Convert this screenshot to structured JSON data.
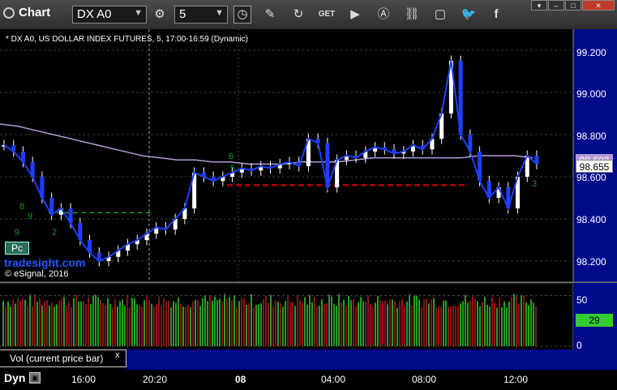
{
  "toolbar": {
    "app_title": "Chart",
    "symbol": "DX A0",
    "interval": "5",
    "buttons": [
      "settings-icon",
      "clock-icon",
      "pencil-icon",
      "refresh-icon",
      "get-icon",
      "play-icon",
      "alert-icon",
      "link-icon",
      "comment-icon",
      "twitter-icon",
      "facebook-icon"
    ],
    "window_buttons": [
      "pin-icon",
      "minimize-icon",
      "maximize-icon",
      "close-icon"
    ]
  },
  "chart": {
    "header": "* DX A0, US DOLLAR INDEX FUTURES, 5, 17:00-16:59 (Dynamic)",
    "y_ticks": [
      "99.200",
      "99.000",
      "98.800",
      "98.600",
      "98.400",
      "98.200"
    ],
    "ma_flag": "98.692",
    "last_flag": "98.655",
    "pc_label": "Pc",
    "brand": "tradesight.com",
    "copyright": "© eSignal, 2016",
    "annotations": [
      "6",
      "5",
      "8",
      "9",
      "9",
      "2",
      "3"
    ],
    "colors": {
      "price": "#1f3fff",
      "ma": "#b49bd6",
      "support": "#e00000",
      "level": "#1a9a1a",
      "axis_bg": "#000a8a"
    }
  },
  "volume": {
    "label": "Vol (current price bar)",
    "close": "x",
    "y_ticks": [
      "50",
      "0"
    ],
    "last_value": "29"
  },
  "x_axis": {
    "mode": "Dyn",
    "ticks": [
      "16:00",
      "20:20",
      "08",
      "04:00",
      "08:00",
      "12:00"
    ]
  },
  "chart_data": {
    "type": "candlestick",
    "title": "* DX A0, US DOLLAR INDEX FUTURES, 5, 17:00-16:59 (Dynamic)",
    "ylim": [
      98.1,
      99.3
    ],
    "x_ticks": [
      "16:00",
      "20:20",
      "08",
      "04:00",
      "08:00",
      "12:00"
    ],
    "series": [
      {
        "name": "price",
        "values": [
          98.75,
          98.72,
          98.67,
          98.6,
          98.5,
          98.42,
          98.45,
          98.38,
          98.3,
          98.24,
          98.2,
          98.22,
          98.25,
          98.28,
          98.3,
          98.33,
          98.36,
          98.35,
          98.4,
          98.45,
          98.62,
          98.6,
          98.58,
          98.6,
          98.62,
          98.64,
          98.63,
          98.65,
          98.64,
          98.66,
          98.67,
          98.65,
          98.78,
          98.76,
          98.55,
          98.68,
          98.7,
          98.69,
          98.72,
          98.74,
          98.73,
          98.71,
          98.72,
          98.75,
          98.73,
          98.78,
          98.9,
          99.15,
          98.8,
          98.72,
          98.58,
          98.5,
          98.55,
          98.45,
          98.6,
          98.7,
          98.66
        ]
      },
      {
        "name": "moving average",
        "values": [
          98.85,
          98.84,
          98.82,
          98.8,
          98.78,
          98.76,
          98.74,
          98.72,
          98.7,
          98.69,
          98.68,
          98.68,
          98.67,
          98.67,
          98.66,
          98.66,
          98.66,
          98.67,
          98.67,
          98.67,
          98.68,
          98.69,
          98.69,
          98.69,
          98.69,
          98.69,
          98.69,
          98.7,
          98.7,
          98.7,
          98.69
        ]
      },
      {
        "name": "support",
        "values": [
          98.56
        ]
      },
      {
        "name": "level",
        "values": [
          98.43
        ]
      }
    ],
    "volume": {
      "ylim": [
        0,
        60
      ],
      "last": 29
    }
  }
}
